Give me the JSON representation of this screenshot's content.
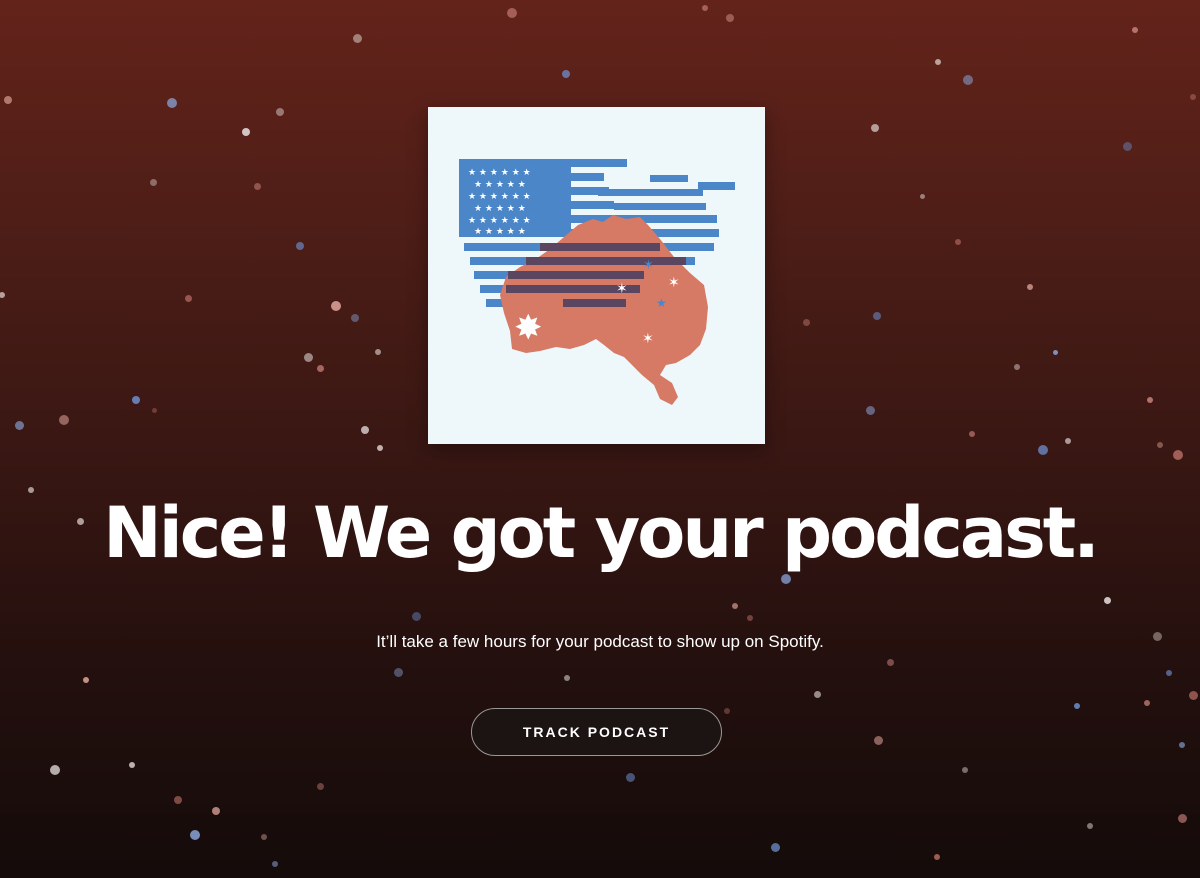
{
  "colors": {
    "background_top": "#63231a",
    "background_bottom": "#140b0a",
    "headline": "#ffffff",
    "button_bg": "#1b1413",
    "button_border": "#9b9795",
    "artwork_bg": "#eef7fa",
    "flag_blue": "#4a86c8",
    "map_red": "#d67a66",
    "overlap_navy": "#5a4660"
  },
  "artwork": {
    "icon": "us-australia-flag-map-artwork"
  },
  "headline": "Nice! We got your podcast.",
  "subtext": "It’ll take a few hours for your podcast to show up on Spotify.",
  "track_button": {
    "label": "TRACK PODCAST"
  }
}
